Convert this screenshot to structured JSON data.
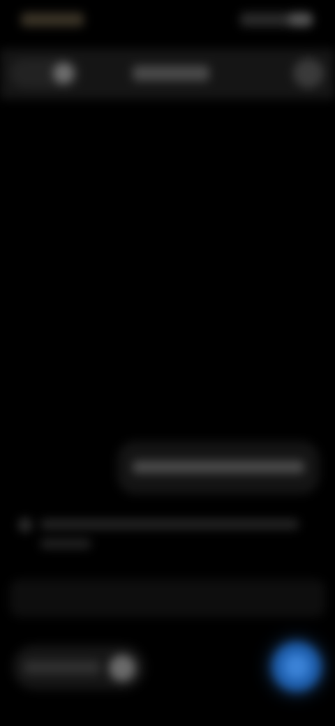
{
  "status_bar": {
    "time": "",
    "icons": [
      "signal-icon",
      "wifi-icon",
      "battery-icon"
    ]
  },
  "header": {
    "title": "",
    "back_icon": "back-icon",
    "right_icon": "more-icon"
  },
  "conversation": {
    "sent_message": "",
    "received_message": ""
  },
  "composer": {
    "placeholder": "",
    "tools_label": "",
    "send_icon": "send-icon"
  },
  "colors": {
    "background": "#000000",
    "accent": "#1e5fae"
  }
}
